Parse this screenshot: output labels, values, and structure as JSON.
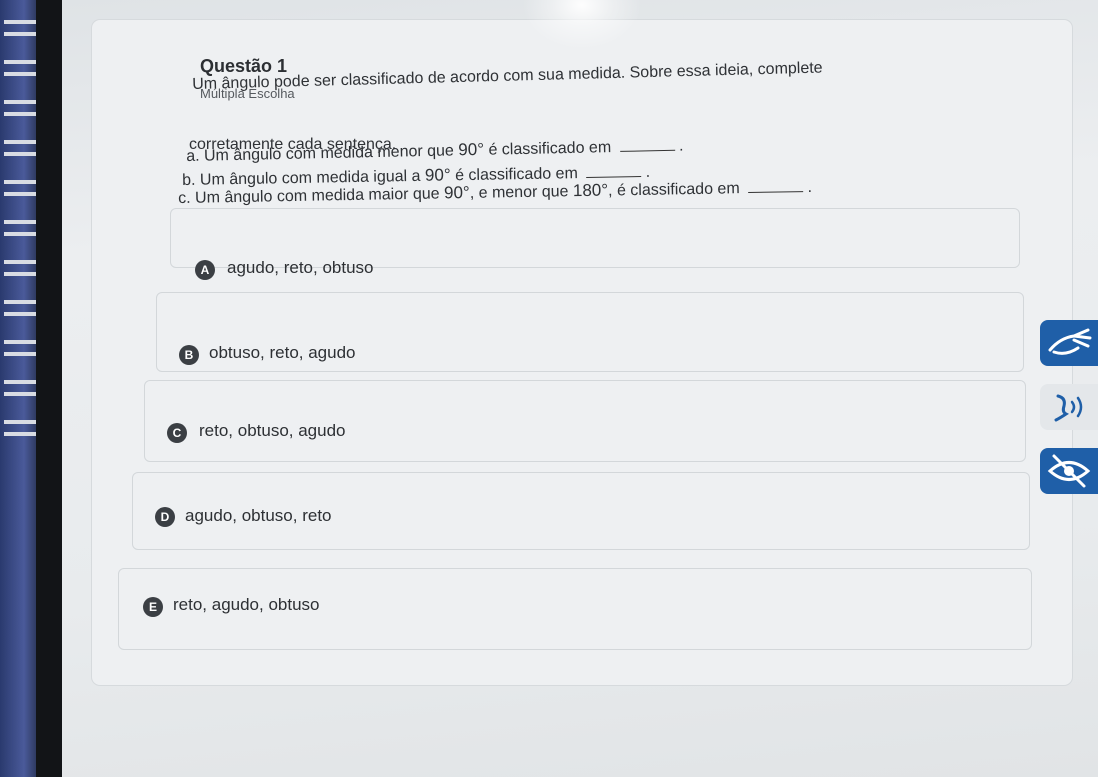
{
  "question": {
    "title": "Questão 1",
    "type": "Múltipla Escolha",
    "stem_line1": "Um ângulo pode ser classificado de acordo com sua medida. Sobre essa ideia, complete",
    "stem_line2": "corretamente cada sentença.",
    "item_a_text": "a. Um ângulo com medida menor que",
    "item_a_value": "90°",
    "item_a_end": "é classificado em",
    "item_b_text": "b. Um ângulo com medida igual a",
    "item_b_value": "90°",
    "item_b_end": "é classificado em",
    "item_c_text": "c. Um ângulo com medida maior que",
    "item_c_value1": "90°",
    "item_c_mid": ", e menor que",
    "item_c_value2": "180°",
    "item_c_end": ", é classificado em",
    "period": "."
  },
  "options": [
    {
      "letter": "A",
      "label": "agudo, reto, obtuso"
    },
    {
      "letter": "B",
      "label": "obtuso, reto, agudo"
    },
    {
      "letter": "C",
      "label": "reto, obtuso, agudo"
    },
    {
      "letter": "D",
      "label": "agudo, obtuso, reto"
    },
    {
      "letter": "E",
      "label": "reto, agudo, obtuso"
    }
  ],
  "side_tools": [
    {
      "icon": "sign-language-icon"
    },
    {
      "icon": "audio-reader-icon"
    },
    {
      "icon": "hide-eye-icon"
    }
  ],
  "colors": {
    "accent": "#1f5fa8",
    "badge": "#3b3f44"
  }
}
